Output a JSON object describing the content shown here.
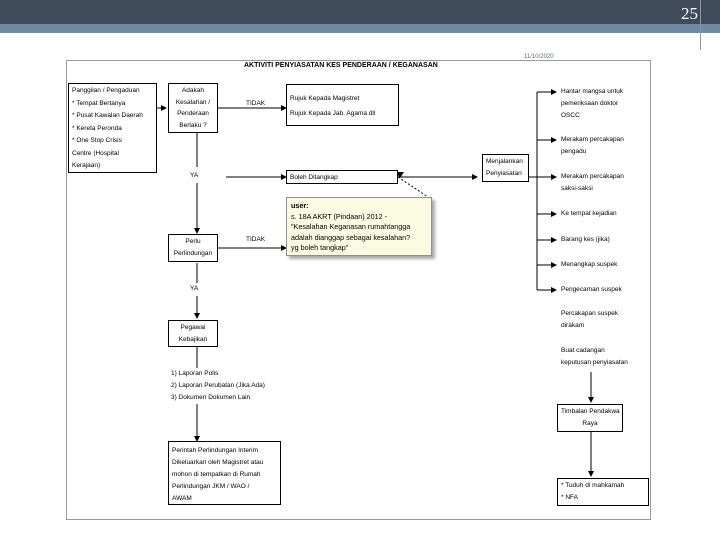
{
  "slide": {
    "number": "25",
    "date": "11/10/2020"
  },
  "flow": {
    "title": "AKTIVITI PENYIASATAN KES PENDERAAN / KEGANASAN",
    "intake": [
      "Panggilan / Pengaduan",
      "* Tempat Bertanya",
      "* Pusat Kawalan Daerah",
      "* Kereta Peronda",
      "* One Stop Crisis",
      "  Centre (Hospital",
      "  Kerajaan)"
    ],
    "decision": [
      "Adakah",
      "Kesalahan /",
      "Penderaan",
      "Berlaku ?"
    ],
    "tidak_1": "TIDAK",
    "referral": [
      "Rujuk Kepada Magistret",
      "Rujuk Kepada Jab. Agama dll"
    ],
    "ya_1": "YA",
    "boleh_tangkap": "Boleh Ditangkap",
    "perintah": [
      "Perlu",
      "Perlindungan"
    ],
    "tidak_2": "TIDAK",
    "ya_2": "YA",
    "pegawai": [
      "Pegawai",
      "Kebajikan"
    ],
    "laporan": [
      "1)  Laporan  Polis",
      "2)  Laporan Perubatan (Jika Ada)",
      "3)  Dokumen  Dokumen Lain"
    ],
    "interim": [
      "Perintah  Perlindungan  Interim",
      "Dikeluarkan oleh Magistret atau",
      "mohon di tempatkan di Rumah",
      "Perlindungan JKM / WAO /",
      "AWAM"
    ],
    "menjalankan": [
      "Menjalankan",
      "Penyiasatan"
    ],
    "steps": [
      [
        "Hantar mangsa untuk",
        "pemeriksaan doktor",
        "OSCC"
      ],
      [
        "Merakam percakapan",
        "pengadu"
      ],
      [
        "Merakam percakapan",
        "saksi-saksi"
      ],
      [
        "Ke  tempat kejadian"
      ],
      [
        "Barang kes (jika)"
      ],
      [
        "Menangkap suspek"
      ],
      [
        "Pengecaman suspek"
      ],
      [
        "Percakapan suspek",
        "dirakam"
      ],
      [
        "Buat cadangan",
        "keputusan penyiasatan"
      ]
    ],
    "timbalan": [
      "Timbalan Pendakwa",
      "Raya"
    ],
    "results": [
      "*  Tuduh di mahkamah",
      "*  NFA"
    ]
  },
  "note": {
    "heading": "user:",
    "lines": [
      "s. 18A AKRT (Pindaan) 2012 -",
      "\"Kesalahan Keganasan rumahtangga",
      "adalah dianggap sebagai kesalahan?",
      "yg boleh tangkap\""
    ]
  }
}
